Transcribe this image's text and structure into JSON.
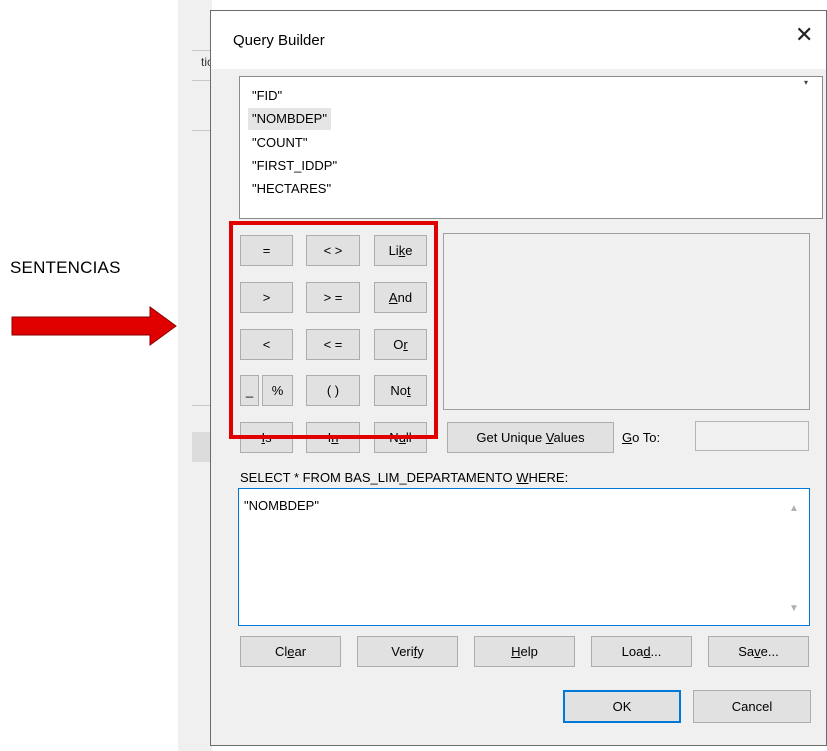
{
  "annotation": {
    "label": "SENTENCIAS",
    "arrow_color": "#e00000"
  },
  "background_app": {
    "partial_text": "tic"
  },
  "dialog": {
    "title": "Query Builder",
    "close_glyph": "✕",
    "fields": [
      "\"FID\"",
      "\"NOMBDEP\"",
      "\"COUNT\"",
      "\"FIRST_IDDP\"",
      "\"HECTARES\""
    ],
    "selected_field": "\"NOMBDEP\"",
    "operators": {
      "eq": "=",
      "neq": "< >",
      "like": "Like",
      "gt": ">",
      "gte": "> =",
      "and": "And",
      "lt": "<",
      "lte": "< =",
      "or": "Or",
      "underscore": "_",
      "percent": "%",
      "parens": "( )",
      "not": "Not",
      "is": "Is",
      "in": "In",
      "null": "Null"
    },
    "get_unique_values": "Get Unique Values",
    "go_to_label": "Go To:",
    "go_to_value": "",
    "sql_prefix": "SELECT * FROM BAS_LIM_DEPARTAMENTO WHERE:",
    "sql_expression": "\"NOMBDEP\"",
    "buttons": {
      "clear": "Clear",
      "verify": "Verify",
      "help": "Help",
      "load": "Load...",
      "save": "Save...",
      "ok": "OK",
      "cancel": "Cancel"
    },
    "highlight_color": "#e00000",
    "focus_color": "#0078d7"
  }
}
